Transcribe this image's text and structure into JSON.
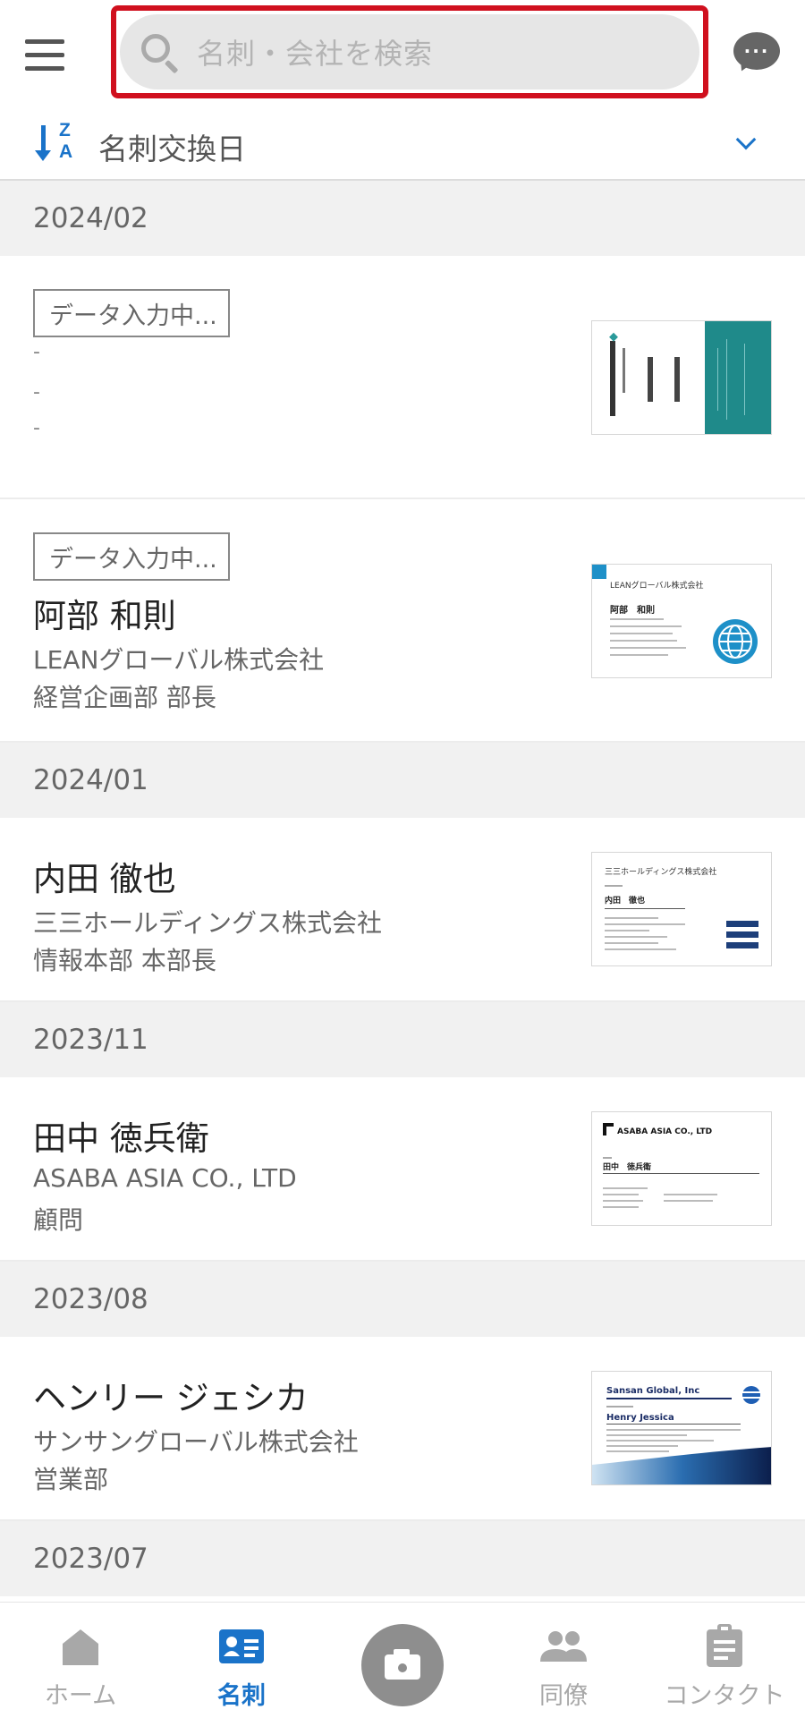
{
  "header": {
    "search_placeholder": "名刺・会社を検索",
    "chat_dots": "···"
  },
  "sort": {
    "z_letter": "Z",
    "a_letter": "A",
    "label": "名刺交換日"
  },
  "sections": [
    {
      "month": "2024/02",
      "cards": [
        {
          "status": "データ入力中...",
          "lines": [
            "-",
            "-",
            "-"
          ]
        },
        {
          "status": "データ入力中...",
          "name": "阿部 和則",
          "company": "LEANグローバル株式会社",
          "dept": "経営企画部 部長"
        }
      ]
    },
    {
      "month": "2024/01",
      "cards": [
        {
          "name": "内田 徹也",
          "company": "三三ホールディングス株式会社",
          "dept": "情報本部 本部長"
        }
      ]
    },
    {
      "month": "2023/11",
      "cards": [
        {
          "name": "田中 徳兵衛",
          "company": "ASABA ASIA CO., LTD",
          "dept": "顧問"
        }
      ]
    },
    {
      "month": "2023/08",
      "cards": [
        {
          "name": "ヘンリー ジェシカ",
          "company": "サンサングローバル株式会社",
          "dept": "営業部"
        }
      ]
    },
    {
      "month": "2023/07",
      "cards": []
    }
  ],
  "thumbnails": {
    "card2_company": "LEANグローバル株式会社",
    "card2_name": "阿部　和則",
    "card3_company": "三三ホールディングス株式会社",
    "card3_name": "内田　徹也",
    "card4_company": "ASABA ASIA CO., LTD",
    "card4_name": "田中　徳兵衛",
    "card5_company": "Sansan Global, Inc",
    "card5_name": "Henry Jessica"
  },
  "bottom_nav": {
    "home": "ホーム",
    "cards": "名刺",
    "colleagues": "同僚",
    "contacts": "コンタクト"
  },
  "colors": {
    "accent": "#1a73c9",
    "highlight": "#d0101e",
    "section_bg": "#f1f1f1"
  }
}
